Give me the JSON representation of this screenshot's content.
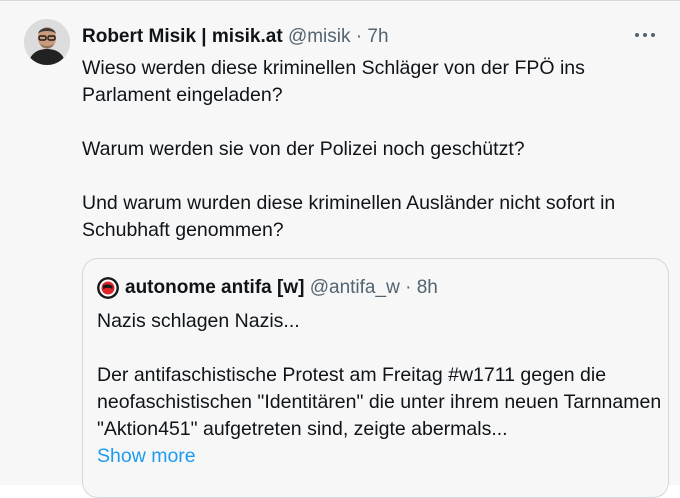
{
  "tweet": {
    "author": {
      "display_name": "Robert Misik | misik.at",
      "handle": "@misik",
      "separator": "·",
      "time": "7h",
      "avatar_icon": "profile-photo"
    },
    "more_icon": "ellipsis-icon",
    "paragraphs": [
      "Wieso werden diese kriminellen Schläger von der FPÖ ins Parlament eingeladen?",
      "Warum werden sie von der Polizei noch geschützt?",
      "Und warum wurden diese kriminellen Ausländer nicht sofort in Schubhaft genommen?"
    ]
  },
  "quote": {
    "author": {
      "display_name": "autonome antifa [w]",
      "handle": "@antifa_w",
      "separator": "·",
      "time": "8h",
      "avatar_icon": "antifa-flag-logo"
    },
    "paragraphs": [
      "Nazis schlagen Nazis...",
      "Der antifaschistische Protest am Freitag #w1711 gegen die neofaschistischen \"Identitären\" die unter ihrem neuen Tarnnamen \"Aktion451\" aufgetreten sind, zeigte abermals..."
    ],
    "show_more_label": "Show more"
  },
  "colors": {
    "background": "#f7f7f7",
    "text": "#0f1419",
    "secondary_text": "#536471",
    "link": "#1d9bf0",
    "border": "#cfd9de",
    "antifa_red": "#e0242b"
  }
}
